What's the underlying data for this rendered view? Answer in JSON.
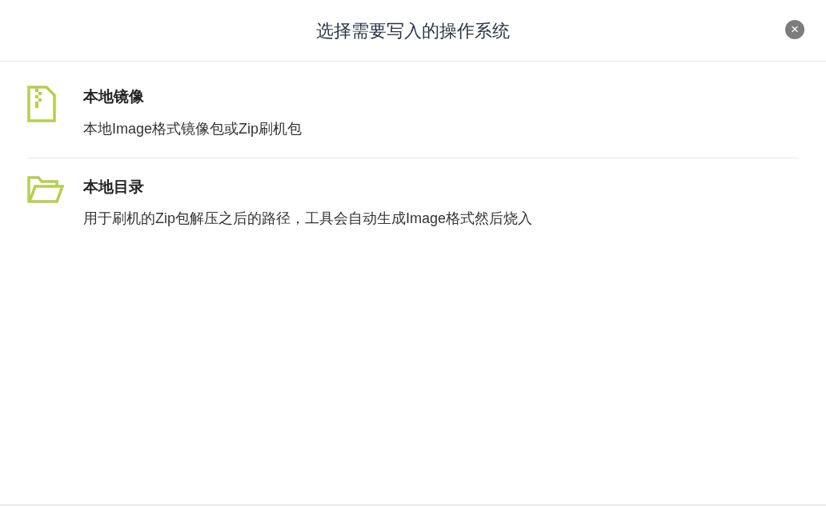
{
  "dialog": {
    "title": "选择需要写入的操作系统",
    "close": "×"
  },
  "options": [
    {
      "kind": "zip-file",
      "title": "本地镜像",
      "description": "本地Image格式镜像包或Zip刷机包"
    },
    {
      "kind": "folder",
      "title": "本地目录",
      "description": "用于刷机的Zip包解压之后的路径，工具会自动生成Image格式然后烧入"
    }
  ]
}
